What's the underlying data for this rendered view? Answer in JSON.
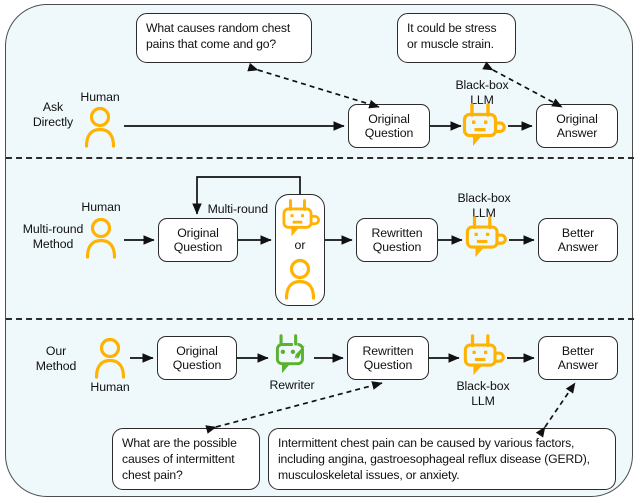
{
  "figure": {
    "title": "Question rewriting pipelines comparison",
    "accent_yellow": "#FFB200",
    "accent_orange": "#F5A623",
    "accent_green": "#5BB230",
    "panel_background": "#EFF9FB",
    "stroke": "#2B2B2B"
  },
  "rows": {
    "ask_directly": {
      "row_label": "Ask Directly",
      "human_label": "Human",
      "llm_label": "Black-box\nLLM",
      "llm_label_line1": "Black-box",
      "llm_label_line2": "LLM",
      "nodes": {
        "original_question_line1": "Original",
        "original_question_line2": "Question",
        "original_answer_line1": "Original",
        "original_answer_line2": "Answer"
      },
      "bubbles": {
        "question": "What causes random chest pains that come and go?",
        "answer": "It could be stress or muscle strain."
      }
    },
    "multi_round": {
      "row_label_line1": "Multi-round",
      "row_label_line2": "Method",
      "human_label": "Human",
      "loop_label": "Multi-round",
      "or_label": "or",
      "llm_label_line1": "Black-box",
      "llm_label_line2": "LLM",
      "nodes": {
        "original_question_line1": "Original",
        "original_question_line2": "Question",
        "rewritten_question_line1": "Rewritten",
        "rewritten_question_line2": "Question",
        "better_answer_line1": "Better",
        "better_answer_line2": "Answer"
      }
    },
    "our_method": {
      "row_label_line1": "Our",
      "row_label_line2": "Method",
      "human_label": "Human",
      "rewriter_label": "Rewriter",
      "llm_label_line1": "Black-box",
      "llm_label_line2": "LLM",
      "nodes": {
        "original_question_line1": "Original",
        "original_question_line2": "Question",
        "rewritten_question_line1": "Rewritten",
        "rewritten_question_line2": "Question",
        "better_answer_line1": "Better",
        "better_answer_line2": "Answer"
      },
      "bubbles": {
        "question": "What are the possible causes of intermittent chest pain?",
        "answer": "Intermittent chest pain can be caused by various factors, including angina, gastroesophageal reflux disease (GERD), musculoskeletal issues, or anxiety."
      }
    }
  },
  "icons": {
    "human": "person-icon",
    "llm": "robot-icon",
    "rewriter": "robot-pencil-icon"
  }
}
